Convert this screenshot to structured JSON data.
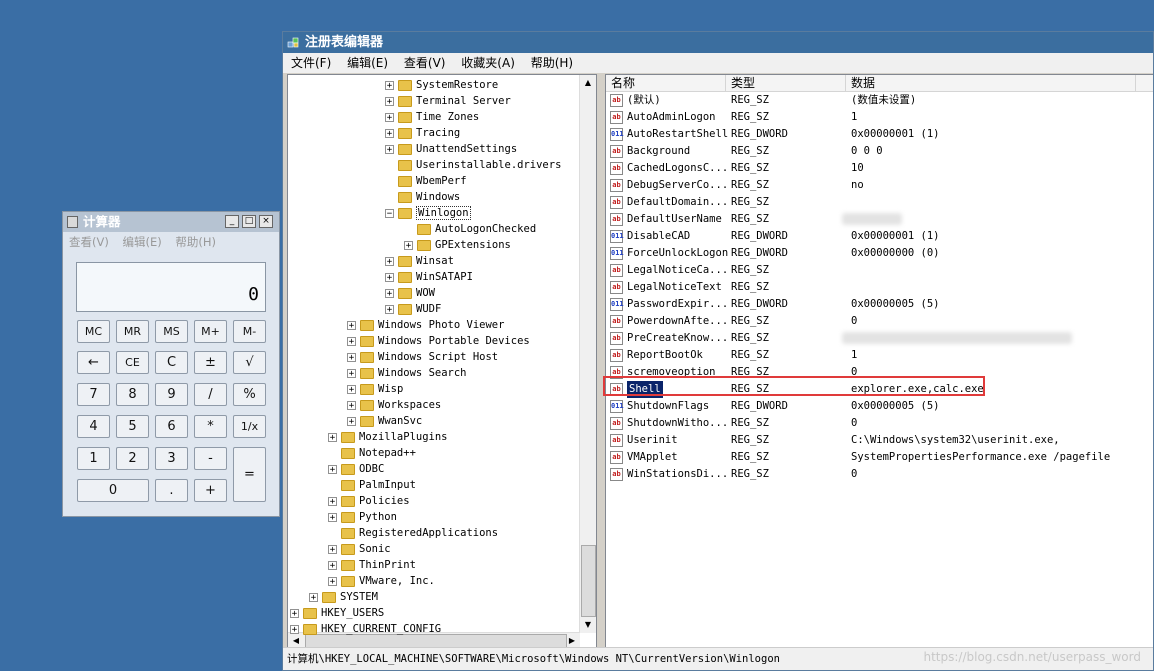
{
  "registry": {
    "title": "注册表编辑器",
    "menu": [
      "文件(F)",
      "编辑(E)",
      "查看(V)",
      "收藏夹(A)",
      "帮助(H)"
    ],
    "tree": [
      {
        "label": "SystemRestore",
        "indent": 5,
        "exp": "+"
      },
      {
        "label": "Terminal Server",
        "indent": 5,
        "exp": "+"
      },
      {
        "label": "Time Zones",
        "indent": 5,
        "exp": "+"
      },
      {
        "label": "Tracing",
        "indent": 5,
        "exp": "+"
      },
      {
        "label": "UnattendSettings",
        "indent": 5,
        "exp": "+"
      },
      {
        "label": "Userinstallable.drivers",
        "indent": 5,
        "exp": ""
      },
      {
        "label": "WbemPerf",
        "indent": 5,
        "exp": ""
      },
      {
        "label": "Windows",
        "indent": 5,
        "exp": ""
      },
      {
        "label": "Winlogon",
        "indent": 5,
        "exp": "−",
        "selected": true
      },
      {
        "label": "AutoLogonChecked",
        "indent": 6,
        "exp": ""
      },
      {
        "label": "GPExtensions",
        "indent": 6,
        "exp": "+"
      },
      {
        "label": "Winsat",
        "indent": 5,
        "exp": "+"
      },
      {
        "label": "WinSATAPI",
        "indent": 5,
        "exp": "+"
      },
      {
        "label": "WOW",
        "indent": 5,
        "exp": "+"
      },
      {
        "label": "WUDF",
        "indent": 5,
        "exp": "+"
      },
      {
        "label": "Windows Photo Viewer",
        "indent": 3,
        "exp": "+"
      },
      {
        "label": "Windows Portable Devices",
        "indent": 3,
        "exp": "+"
      },
      {
        "label": "Windows Script Host",
        "indent": 3,
        "exp": "+"
      },
      {
        "label": "Windows Search",
        "indent": 3,
        "exp": "+"
      },
      {
        "label": "Wisp",
        "indent": 3,
        "exp": "+"
      },
      {
        "label": "Workspaces",
        "indent": 3,
        "exp": "+"
      },
      {
        "label": "WwanSvc",
        "indent": 3,
        "exp": "+"
      },
      {
        "label": "MozillaPlugins",
        "indent": 2,
        "exp": "+"
      },
      {
        "label": "Notepad++",
        "indent": 2,
        "exp": ""
      },
      {
        "label": "ODBC",
        "indent": 2,
        "exp": "+"
      },
      {
        "label": "PalmInput",
        "indent": 2,
        "exp": ""
      },
      {
        "label": "Policies",
        "indent": 2,
        "exp": "+"
      },
      {
        "label": "Python",
        "indent": 2,
        "exp": "+"
      },
      {
        "label": "RegisteredApplications",
        "indent": 2,
        "exp": ""
      },
      {
        "label": "Sonic",
        "indent": 2,
        "exp": "+"
      },
      {
        "label": "ThinPrint",
        "indent": 2,
        "exp": "+"
      },
      {
        "label": "VMware, Inc.",
        "indent": 2,
        "exp": "+"
      },
      {
        "label": "SYSTEM",
        "indent": 1,
        "exp": "+"
      },
      {
        "label": "HKEY_USERS",
        "indent": 0,
        "exp": "+"
      },
      {
        "label": "HKEY_CURRENT_CONFIG",
        "indent": 0,
        "exp": "+"
      }
    ],
    "columns": [
      "名称",
      "类型",
      "数据"
    ],
    "values": [
      {
        "name": "(默认)",
        "type": "REG_SZ",
        "data": "(数值未设置)",
        "icon": "sz"
      },
      {
        "name": "AutoAdminLogon",
        "type": "REG_SZ",
        "data": "1",
        "icon": "sz"
      },
      {
        "name": "AutoRestartShell",
        "type": "REG_DWORD",
        "data": "0x00000001 (1)",
        "icon": "dw"
      },
      {
        "name": "Background",
        "type": "REG_SZ",
        "data": "0 0 0",
        "icon": "sz"
      },
      {
        "name": "CachedLogonsC...",
        "type": "REG_SZ",
        "data": "10",
        "icon": "sz"
      },
      {
        "name": "DebugServerCo...",
        "type": "REG_SZ",
        "data": "no",
        "icon": "sz"
      },
      {
        "name": "DefaultDomain...",
        "type": "REG_SZ",
        "data": "",
        "icon": "sz"
      },
      {
        "name": "DefaultUserName",
        "type": "REG_SZ",
        "data": "",
        "icon": "sz",
        "blur": 60
      },
      {
        "name": "DisableCAD",
        "type": "REG_DWORD",
        "data": "0x00000001 (1)",
        "icon": "dw"
      },
      {
        "name": "ForceUnlockLogon",
        "type": "REG_DWORD",
        "data": "0x00000000 (0)",
        "icon": "dw"
      },
      {
        "name": "LegalNoticeCa...",
        "type": "REG_SZ",
        "data": "",
        "icon": "sz"
      },
      {
        "name": "LegalNoticeText",
        "type": "REG_SZ",
        "data": "",
        "icon": "sz"
      },
      {
        "name": "PasswordExpir...",
        "type": "REG_DWORD",
        "data": "0x00000005 (5)",
        "icon": "dw"
      },
      {
        "name": "PowerdownAfte...",
        "type": "REG_SZ",
        "data": "0",
        "icon": "sz"
      },
      {
        "name": "PreCreateKnow...",
        "type": "REG_SZ",
        "data": "",
        "icon": "sz",
        "blur": 230
      },
      {
        "name": "ReportBootOk",
        "type": "REG_SZ",
        "data": "1",
        "icon": "sz"
      },
      {
        "name": "scremoveoption",
        "type": "REG_SZ",
        "data": "0",
        "icon": "sz"
      },
      {
        "name": "Shell",
        "type": "REG_SZ",
        "data": "explorer.exe,calc.exe",
        "icon": "sz",
        "selected": true
      },
      {
        "name": "ShutdownFlags",
        "type": "REG_DWORD",
        "data": "0x00000005 (5)",
        "icon": "dw"
      },
      {
        "name": "ShutdownWitho...",
        "type": "REG_SZ",
        "data": "0",
        "icon": "sz"
      },
      {
        "name": "Userinit",
        "type": "REG_SZ",
        "data": "C:\\Windows\\system32\\userinit.exe,",
        "icon": "sz"
      },
      {
        "name": "VMApplet",
        "type": "REG_SZ",
        "data": "SystemPropertiesPerformance.exe /pagefile",
        "icon": "sz"
      },
      {
        "name": "WinStationsDi...",
        "type": "REG_SZ",
        "data": "0",
        "icon": "sz"
      }
    ],
    "status_path": "计算机\\HKEY_LOCAL_MACHINE\\SOFTWARE\\Microsoft\\Windows NT\\CurrentVersion\\Winlogon",
    "watermark": "https://blog.csdn.net/userpass_word"
  },
  "calculator": {
    "title": "计算器",
    "menu": [
      "查看(V)",
      "编辑(E)",
      "帮助(H)"
    ],
    "display": "0",
    "buttons": [
      [
        "MC",
        "MR",
        "MS",
        "M+",
        "M-"
      ],
      [
        "←",
        "CE",
        "C",
        "±",
        "√"
      ],
      [
        "7",
        "8",
        "9",
        "/",
        "%"
      ],
      [
        "4",
        "5",
        "6",
        "*",
        "1/x"
      ],
      [
        "1",
        "2",
        "3",
        "-",
        "="
      ],
      [
        "0",
        ".",
        "+"
      ]
    ]
  }
}
